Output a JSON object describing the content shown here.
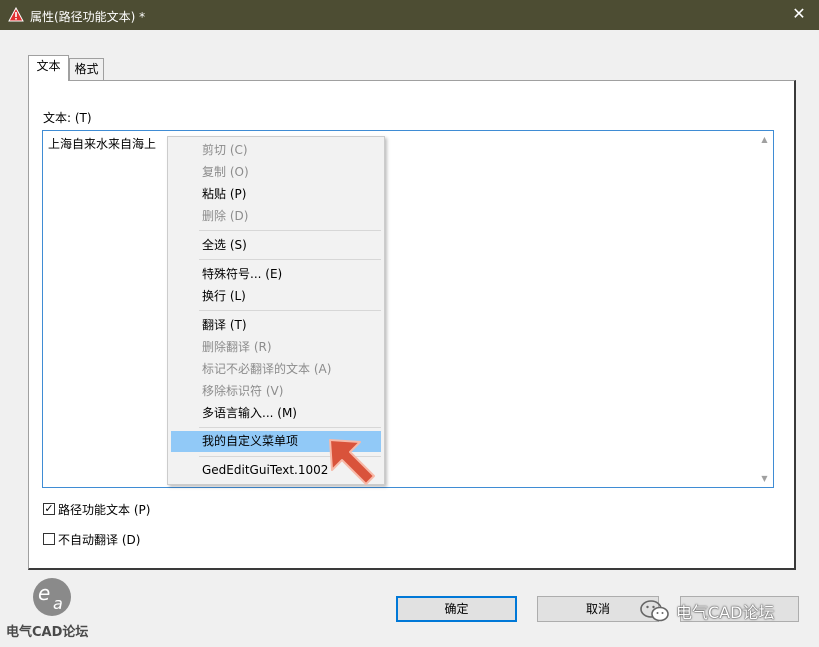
{
  "window": {
    "title": "属性(路径功能文本) *",
    "close_glyph": "✕"
  },
  "tabs": [
    {
      "label": "文本",
      "active": true
    },
    {
      "label": "格式",
      "active": false
    }
  ],
  "text_field": {
    "label": "文本: (T)",
    "value": "上海自来水来自海上"
  },
  "context_menu": {
    "items": [
      {
        "label": "剪切 (C)",
        "enabled": false
      },
      {
        "label": "复制 (O)",
        "enabled": false
      },
      {
        "label": "粘贴 (P)",
        "enabled": true
      },
      {
        "label": "删除 (D)",
        "enabled": false
      },
      {
        "label": "全选 (S)",
        "enabled": true
      },
      {
        "label": "特殊符号... (E)",
        "enabled": true
      },
      {
        "label": "换行 (L)",
        "enabled": true
      },
      {
        "label": "翻译 (T)",
        "enabled": true
      },
      {
        "label": "删除翻译 (R)",
        "enabled": false
      },
      {
        "label": "标记不必翻译的文本 (A)",
        "enabled": false
      },
      {
        "label": "移除标识符 (V)",
        "enabled": false
      },
      {
        "label": "多语言输入... (M)",
        "enabled": true
      },
      {
        "label": "我的自定义菜单项",
        "enabled": true,
        "highlighted": true
      },
      {
        "label": "GedEditGuiText.1002",
        "enabled": true
      }
    ]
  },
  "checkboxes": [
    {
      "label": "路径功能文本 (P)",
      "checked": true,
      "mark": "✓"
    },
    {
      "label": "不自动翻译 (D)",
      "checked": false,
      "mark": ""
    }
  ],
  "buttons": {
    "ok": "确定",
    "cancel": "取消"
  },
  "watermark": {
    "left_text": "电气CAD论坛",
    "right_text": "电气CAD论坛"
  },
  "colors": {
    "titlebar": "#4d4d33",
    "highlight": "#91c9f7",
    "arrow": "#d9533b",
    "focus_border": "#0078d7"
  }
}
